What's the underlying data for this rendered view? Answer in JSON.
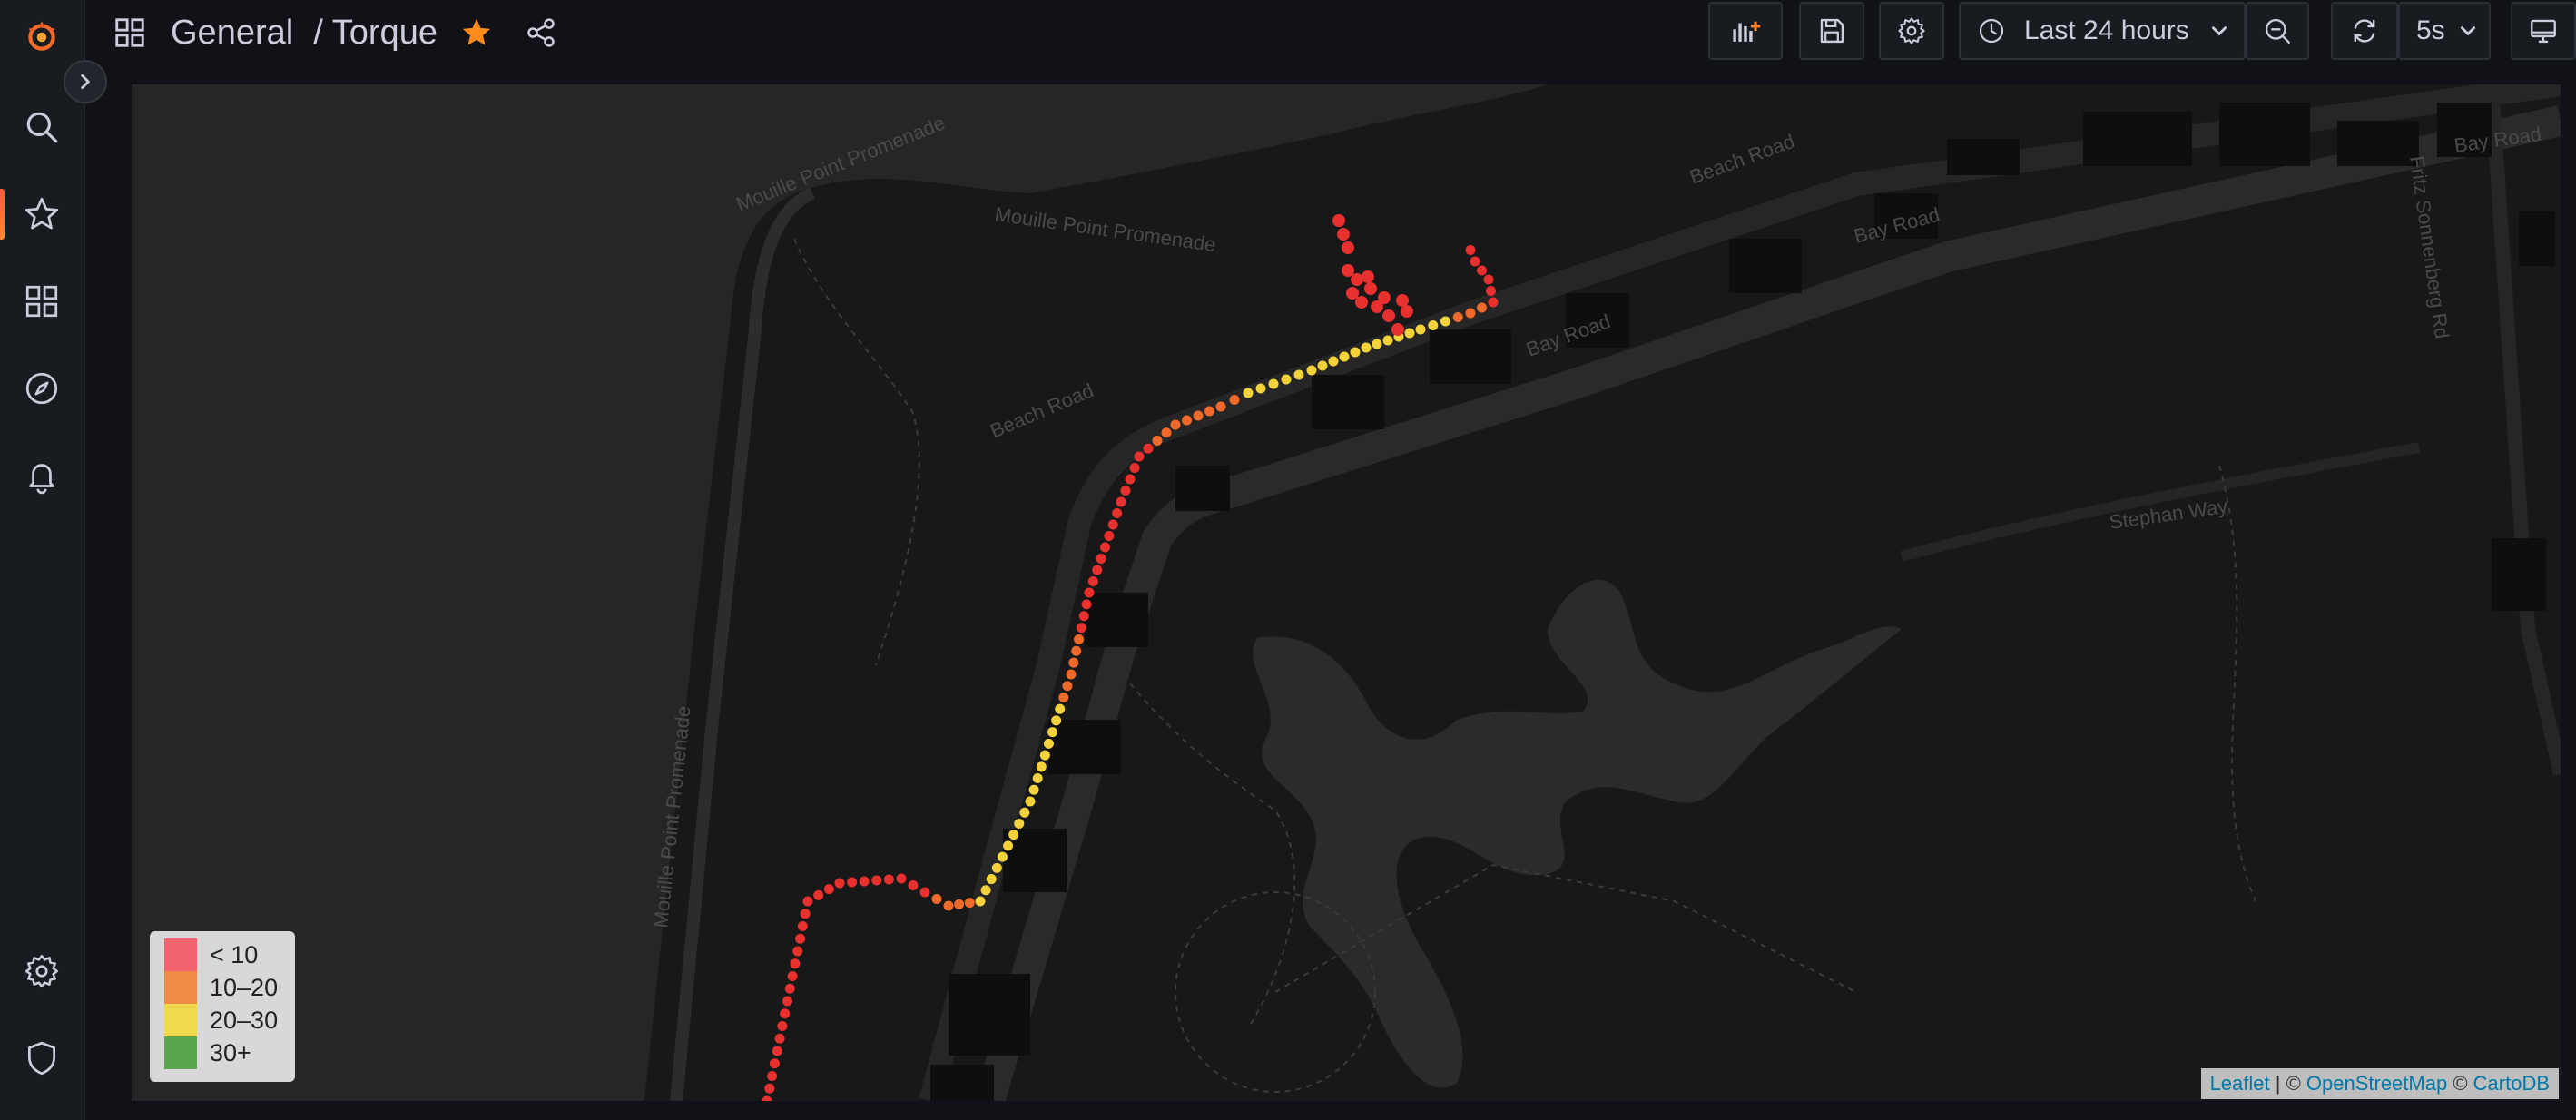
{
  "breadcrumb": {
    "folder": "General",
    "separator": "/",
    "dashboard": "Torque"
  },
  "toolbar": {
    "time_range": "Last 24 hours",
    "refresh_interval": "5s"
  },
  "sidebar": {
    "items": [
      {
        "icon": "grafana-logo-icon"
      },
      {
        "icon": "search-icon"
      },
      {
        "icon": "star-icon",
        "active": true
      },
      {
        "icon": "dashboards-grid-icon"
      },
      {
        "icon": "explore-compass-icon"
      },
      {
        "icon": "alerting-bell-icon"
      },
      {
        "icon": "configuration-gear-icon"
      },
      {
        "icon": "server-admin-shield-icon"
      }
    ]
  },
  "map": {
    "road_labels": [
      "Mouille Point Promenade",
      "Mouille Point Promenade",
      "Mouille Point Promenade",
      "Beach Road",
      "Beach Road",
      "Bay Road",
      "Bay Road",
      "Bay Road",
      "Stephan Way",
      "Fritz Sonnenberg Rd"
    ],
    "legend": [
      {
        "label": "< 10",
        "color": "#f2646d"
      },
      {
        "label": "10–20",
        "color": "#f08a47"
      },
      {
        "label": "20–30",
        "color": "#f0d84f"
      },
      {
        "label": "30+",
        "color": "#5aa64f"
      }
    ],
    "attribution": {
      "leaflet": "Leaflet",
      "sep1": " | © ",
      "osm": "OpenStreetMap",
      "sep2": " © ",
      "carto": "CartoDB"
    }
  },
  "colors": {
    "accent": "#ff8833",
    "star": "#ff8c1a",
    "track_red": "#e8302f",
    "track_orange": "#ef6a2a",
    "track_yellow": "#f3d23c"
  }
}
